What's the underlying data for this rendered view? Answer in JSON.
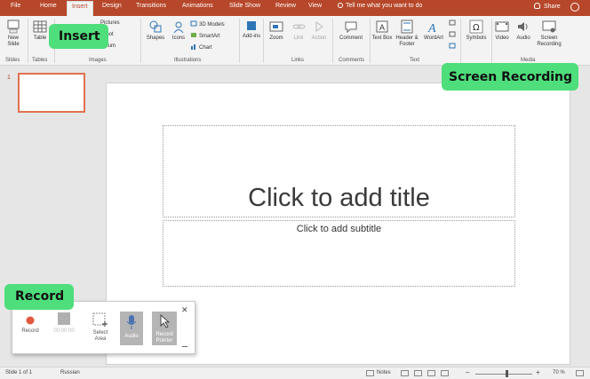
{
  "tabs": [
    {
      "label": "File"
    },
    {
      "label": "Home"
    },
    {
      "label": "Insert"
    },
    {
      "label": "Design"
    },
    {
      "label": "Transitions"
    },
    {
      "label": "Animations"
    },
    {
      "label": "Slide Show"
    },
    {
      "label": "Review"
    },
    {
      "label": "View"
    }
  ],
  "tell_me": "Tell me what you want to do",
  "share": "Share",
  "ribbon": {
    "new_slide": "New Slide",
    "table": "Table",
    "pictures": "Pictures",
    "screenshot": "nshot",
    "album": "Album",
    "shapes": "Shapes",
    "icons": "Icons",
    "models": "3D Models",
    "smartart": "SmartArt",
    "chart": "Chart",
    "addins": "Add-ins",
    "zoom": "Zoom",
    "link": "Link",
    "action": "Action",
    "comment": "Comment",
    "textbox": "Text Box",
    "header_footer": "Header & Footer",
    "wordart": "WordArt",
    "symbols": "Symbols",
    "video": "Video",
    "audio": "Audio",
    "screen_recording": "Screen Recording",
    "groups": {
      "slides": "Slides",
      "tables": "Tables",
      "images": "Images",
      "illustrations": "Illustrations",
      "links": "Links",
      "comments": "Comments",
      "text": "Text",
      "media": "Media"
    }
  },
  "thumbnail": {
    "number": "1"
  },
  "slide": {
    "title_placeholder": "Click to add title",
    "subtitle_placeholder": "Click to add subtitle"
  },
  "recording_toolbar": {
    "record": "Record",
    "time": "00:00:00",
    "select_area": "Select Area",
    "audio": "Audio",
    "record_pointer": "Record Pointer"
  },
  "callouts": {
    "insert": "Insert",
    "screen_recording": "Screen Recording",
    "record": "Record"
  },
  "status": {
    "slide": "Slide 1 of 1",
    "language": "Russian",
    "notes": "Notes",
    "zoom": "70 %"
  },
  "colors": {
    "accent": "#b7472a",
    "callout": "#4ede7b",
    "record_dot": "#e2583e"
  }
}
